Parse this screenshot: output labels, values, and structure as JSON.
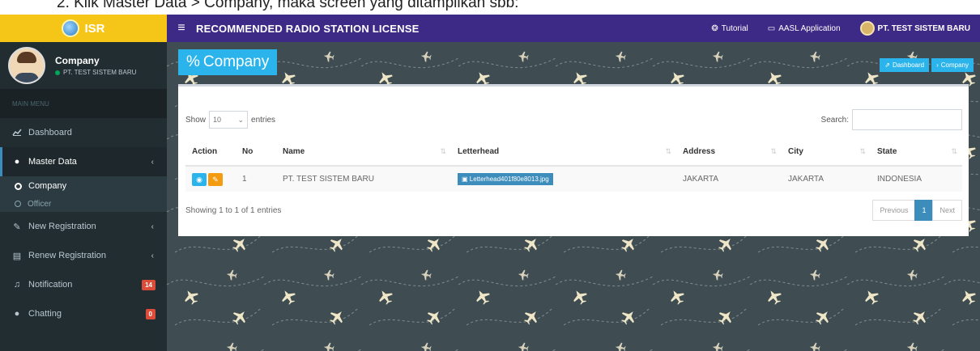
{
  "caption": "2.   Klik Master Data > Company, maka screen yang ditampilkan sbb:",
  "brand": {
    "logo_text": "ISR",
    "accent": "#f5c518"
  },
  "user": {
    "name": "Company",
    "company": "PT. TEST SISTEM BARU"
  },
  "sidebar": {
    "header": "MAIN MENU",
    "items": [
      {
        "label": "Dashboard",
        "icon": "chart-line-icon"
      },
      {
        "label": "Master Data",
        "icon": "circle-icon",
        "sub": [
          {
            "label": "Company"
          },
          {
            "label": "Officer"
          }
        ]
      },
      {
        "label": "New Registration",
        "icon": "file-edit-icon"
      },
      {
        "label": "Renew Registration",
        "icon": "file-icon"
      },
      {
        "label": "Notification",
        "icon": "bell-icon",
        "badge": "14"
      },
      {
        "label": "Chatting",
        "icon": "chat-icon",
        "badge": "0"
      }
    ]
  },
  "topbar": {
    "title": "RECOMMENDED RADIO STATION LICENSE",
    "tutorial": "Tutorial",
    "aasl": "AASL Application",
    "company": "PT. TEST SISTEM BARU",
    "bg_color": "#3c2a86"
  },
  "page": {
    "title": "Company",
    "breadcrumb": [
      "Dashboard",
      "Company"
    ]
  },
  "table_ui": {
    "show_label": "Show",
    "length": "10",
    "entries_label": "entries",
    "search_label": "Search:",
    "columns": [
      "Action",
      "No",
      "Name",
      "Letterhead",
      "Address",
      "City",
      "State"
    ],
    "rows": [
      {
        "no": "1",
        "name": "PT. TEST SISTEM BARU",
        "letterhead": "Letterhead401f80e8013.jpg",
        "address": "JAKARTA",
        "city": "JAKARTA",
        "state": "INDONESIA"
      }
    ],
    "info": "Showing 1 to 1 of 1 entries",
    "pager": {
      "prev": "Previous",
      "current": "1",
      "next": "Next"
    }
  }
}
